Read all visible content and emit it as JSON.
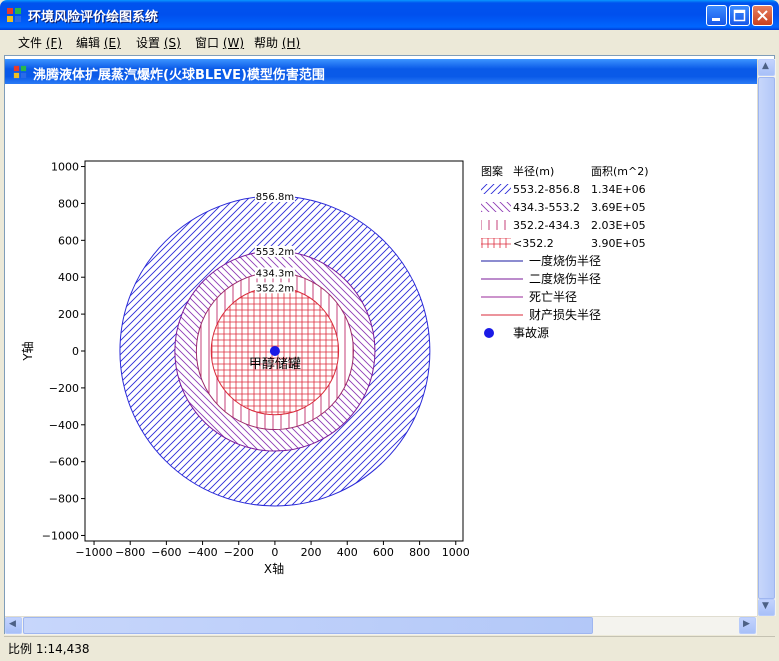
{
  "window": {
    "title": "环境风险评价绘图系统"
  },
  "menu": [
    {
      "label": "文件",
      "key": "(F)"
    },
    {
      "label": "编辑",
      "key": "(E)"
    },
    {
      "label": "设置",
      "key": "(S)"
    },
    {
      "label": "窗口",
      "key": "(W)"
    },
    {
      "label": "帮助",
      "key": "(H)"
    }
  ],
  "child_window": {
    "title": "沸腾液体扩展蒸汽爆炸(火球BLEVE)模型伤害范围"
  },
  "status": {
    "scale": "比例 1:14,438"
  },
  "colors": {
    "blue": "#1a1ae6",
    "violet": "#8e3bb5",
    "red": "#dd2b3c",
    "navy": "#1a1aa0"
  },
  "chart_data": {
    "type": "scatter",
    "xlabel": "X轴",
    "ylabel": "Y轴",
    "xlim": [
      -1050,
      1040
    ],
    "ylim": [
      -1030,
      1030
    ],
    "xticks": [
      -1000,
      -800,
      -600,
      -400,
      -200,
      0,
      200,
      400,
      600,
      800,
      1000
    ],
    "yticks": [
      -1000,
      -800,
      -600,
      -400,
      -200,
      0,
      200,
      400,
      600,
      800,
      1000
    ],
    "center": [
      0,
      0
    ],
    "center_label": "甲醇储罐",
    "circles": [
      {
        "radius": 856.8,
        "label": "856.8m",
        "color": "#2a2ad8",
        "pattern": "diag-fwd"
      },
      {
        "radius": 553.2,
        "label": "553.2m",
        "color": "#7a1a9a",
        "pattern": "diag-bwd"
      },
      {
        "radius": 434.3,
        "label": "434.3m",
        "color": "#9a2a6a",
        "pattern": "vertical"
      },
      {
        "radius": 352.2,
        "label": "352.2m",
        "color": "#d82a3a",
        "pattern": "grid"
      }
    ],
    "legend": {
      "headers": [
        "图案",
        "半径(m)",
        "面积(m^2)"
      ],
      "rows": [
        {
          "range": "553.2-856.8",
          "area": "1.34E+06",
          "pattern": "diag-fwd"
        },
        {
          "range": "434.3-553.2",
          "area": "3.69E+05",
          "pattern": "diag-bwd"
        },
        {
          "range": "352.2-434.3",
          "area": "2.03E+05",
          "pattern": "vertical"
        },
        {
          "range": "<352.2",
          "area": "3.90E+05",
          "pattern": "grid"
        }
      ],
      "lines": [
        {
          "label": "一度烧伤半径",
          "color": "#1a1aa0"
        },
        {
          "label": "二度烧伤半径",
          "color": "#7a1a9a"
        },
        {
          "label": "死亡半径",
          "color": "#9a2a9a"
        },
        {
          "label": "财产损失半径",
          "color": "#d82a3a"
        }
      ],
      "source_label": "事故源"
    }
  }
}
